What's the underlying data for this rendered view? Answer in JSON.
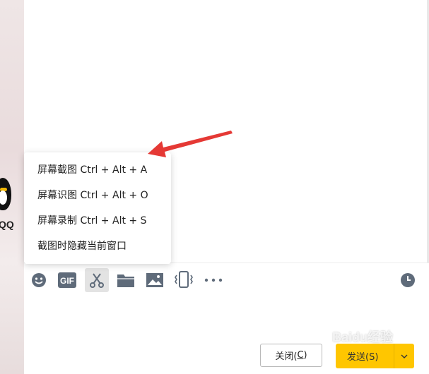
{
  "desktop": {
    "icon_label": "QQ"
  },
  "menu": {
    "items": [
      {
        "label": "屏幕截图 Ctrl + Alt + A"
      },
      {
        "label": "屏幕识图 Ctrl + Alt + O"
      },
      {
        "label": "屏幕录制 Ctrl + Alt + S"
      },
      {
        "label": "截图时隐藏当前窗口"
      }
    ]
  },
  "toolbar": {
    "icons": [
      "emoji-icon",
      "gif-icon",
      "scissors-icon",
      "folder-icon",
      "image-icon",
      "shake-icon",
      "more-icon",
      "history-clock-icon"
    ],
    "gif_text": "GIF",
    "active": "scissors-icon"
  },
  "buttons": {
    "close_label_prefix": "关闭(",
    "close_label_key": "C",
    "close_label_suffix": ")",
    "send_label": "发送(S)"
  },
  "watermark": {
    "text": "Baidu经验"
  },
  "colors": {
    "send": "#ffc600",
    "arrow": "#e53935",
    "active_tool": "#e3e3e3"
  }
}
